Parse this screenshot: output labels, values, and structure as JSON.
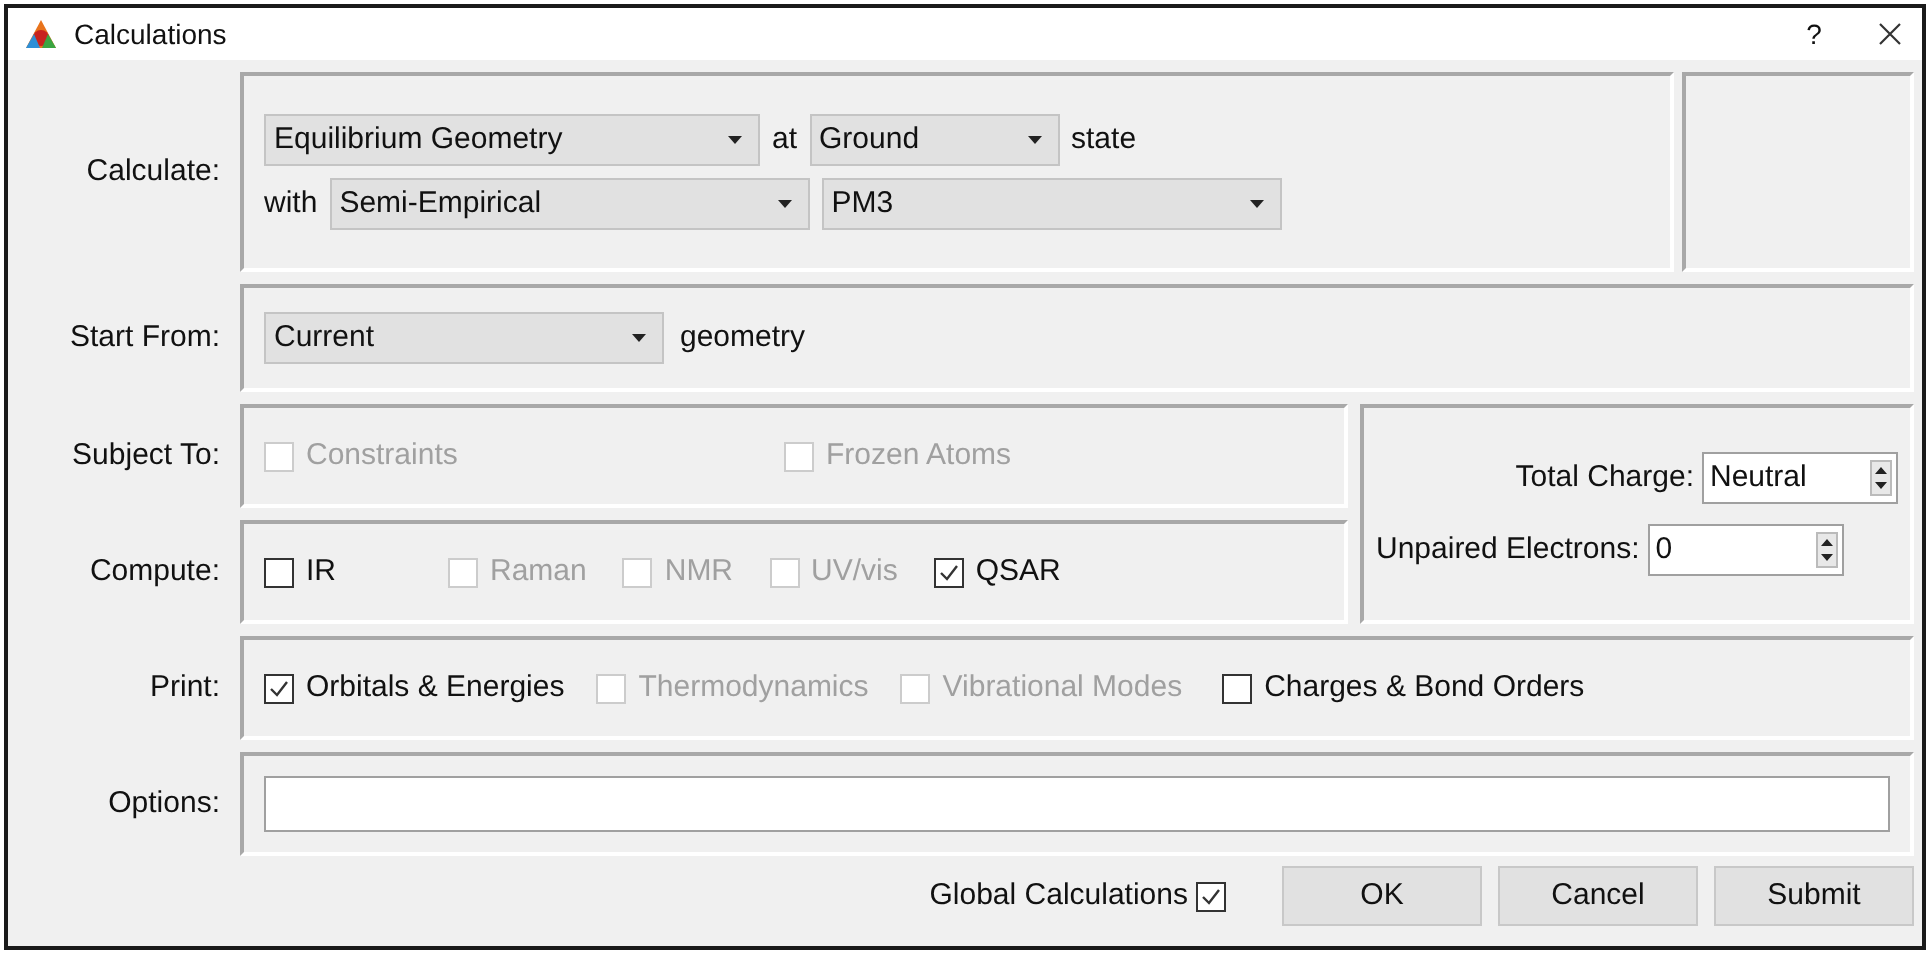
{
  "window": {
    "title": "Calculations",
    "help": "?"
  },
  "calculate": {
    "label": "Calculate:",
    "task": "Equilibrium Geometry",
    "at": "at",
    "state": "Ground",
    "state_suffix": "state",
    "with": "with",
    "method": "Semi-Empirical",
    "model": "PM3"
  },
  "start_from": {
    "label": "Start From:",
    "value": "Current",
    "suffix": "geometry"
  },
  "subject_to": {
    "label": "Subject To:",
    "options": [
      {
        "label": "Constraints",
        "checked": false,
        "disabled": true
      },
      {
        "label": "Frozen Atoms",
        "checked": false,
        "disabled": true
      }
    ]
  },
  "compute": {
    "label": "Compute:",
    "options": [
      {
        "label": "IR",
        "checked": false,
        "disabled": false
      },
      {
        "label": "Raman",
        "checked": false,
        "disabled": true
      },
      {
        "label": "NMR",
        "checked": false,
        "disabled": true
      },
      {
        "label": "UV/vis",
        "checked": false,
        "disabled": true
      },
      {
        "label": "QSAR",
        "checked": true,
        "disabled": false
      }
    ]
  },
  "total_charge": {
    "label": "Total Charge:",
    "value": "Neutral"
  },
  "unpaired_electrons": {
    "label": "Unpaired Electrons:",
    "value": "0"
  },
  "print": {
    "label": "Print:",
    "options": [
      {
        "label": "Orbitals & Energies",
        "checked": true,
        "disabled": false
      },
      {
        "label": "Thermodynamics",
        "checked": false,
        "disabled": true
      },
      {
        "label": "Vibrational Modes",
        "checked": false,
        "disabled": true
      },
      {
        "label": "Charges & Bond Orders",
        "checked": false,
        "disabled": false
      }
    ]
  },
  "options": {
    "label": "Options:"
  },
  "footer": {
    "global_label": "Global Calculations",
    "global_checked": true,
    "buttons": [
      "OK",
      "Cancel",
      "Submit"
    ]
  }
}
